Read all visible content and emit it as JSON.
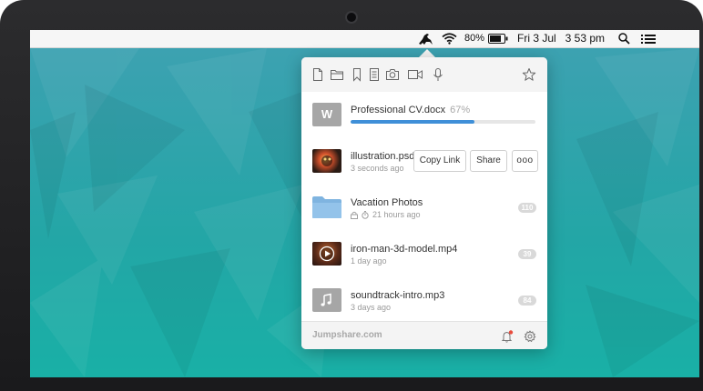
{
  "menubar": {
    "battery_percent": "80%",
    "battery_level": 0.8,
    "clock": "Fri 3 Jul   3 53 pm",
    "icons": [
      "jumpshare-kangaroo-icon",
      "wifi-icon",
      "battery-icon",
      "search-icon",
      "list-icon"
    ]
  },
  "toolbar": {
    "icons": [
      "new-file-icon",
      "folder-icon",
      "bookmark-icon",
      "note-icon",
      "camera-icon",
      "video-icon",
      "microphone-icon",
      "star-icon"
    ]
  },
  "files": {
    "upload": {
      "name": "Professional CV.docx",
      "percent": "67%",
      "progress": 0.67,
      "thumb_letter": "W"
    },
    "illustration": {
      "name": "illustration.psd",
      "time": "3 seconds ago",
      "copy_link": "Copy Link",
      "share": "Share",
      "more": "ooo"
    },
    "folder": {
      "name": "Vacation Photos",
      "time": "21 hours ago",
      "badge": "110"
    },
    "video": {
      "name": "iron-man-3d-model.mp4",
      "time": "1 day ago",
      "badge": "39"
    },
    "audio": {
      "name": "soundtrack-intro.mp3",
      "time": "3 days ago",
      "badge": "84"
    }
  },
  "footer": {
    "brand": "Jumpshare.com",
    "icons": [
      "notification-bell-icon",
      "settings-gear-icon"
    ],
    "notification_dot_color": "#e84b3c"
  },
  "colors": {
    "progress": "#3f8fd8",
    "wallpaper_top": "#3fa1b2",
    "wallpaper_bottom": "#19b0a6"
  }
}
